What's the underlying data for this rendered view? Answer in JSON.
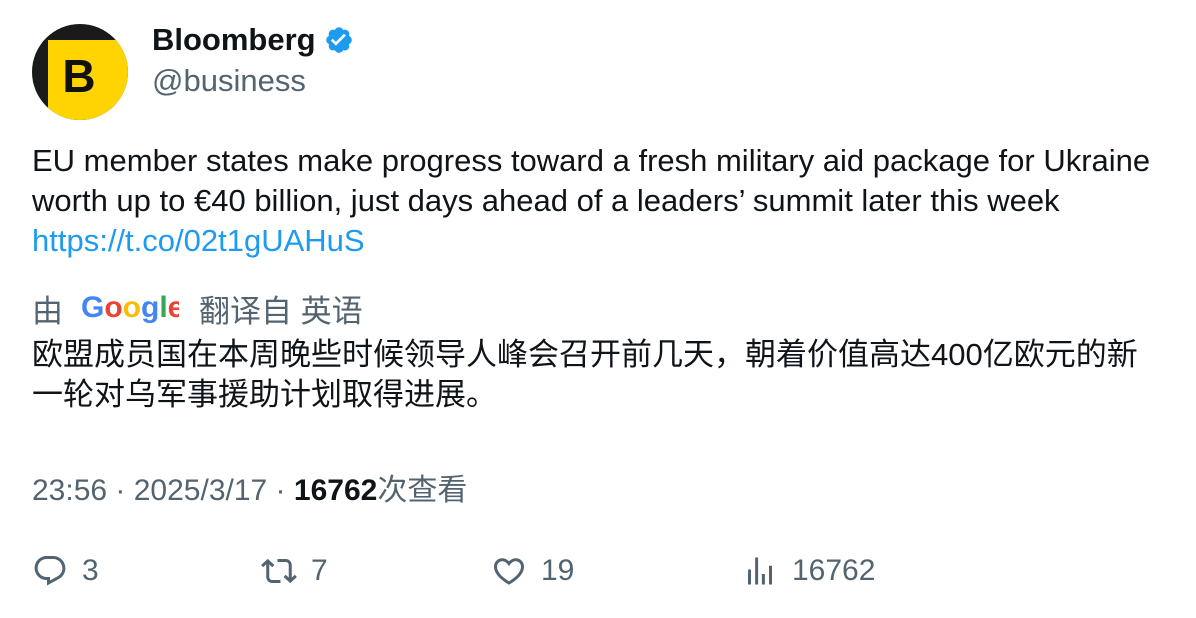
{
  "author": {
    "name": "Bloomberg",
    "handle": "@business",
    "avatar_letter": "B",
    "verified": true
  },
  "tweet": {
    "text": "EU member states make progress toward a fresh military aid package for Ukraine worth up to €40 billion, just days ahead of a leaders’ summit later this week ",
    "link": "https://t.co/02t1gUAHuS"
  },
  "translation": {
    "prefix": "由",
    "provider": "Google",
    "suffix": "翻译自 英语",
    "text": "欧盟成员国在本周晚些时候领导人峰会召开前几天，朝着价值高达400亿欧元的新一轮对乌军事援助计划取得进展。"
  },
  "meta": {
    "time": "23:56",
    "separator": " · ",
    "date": "2025/3/17",
    "separator2": " · ",
    "views": "16762",
    "views_label": "次查看"
  },
  "actions": {
    "replies": "3",
    "retweets": "7",
    "likes": "19",
    "views": "16762"
  },
  "colors": {
    "accent": "#1d9bf0",
    "secondary_text": "#536471",
    "avatar_yellow": "#ffd400"
  }
}
